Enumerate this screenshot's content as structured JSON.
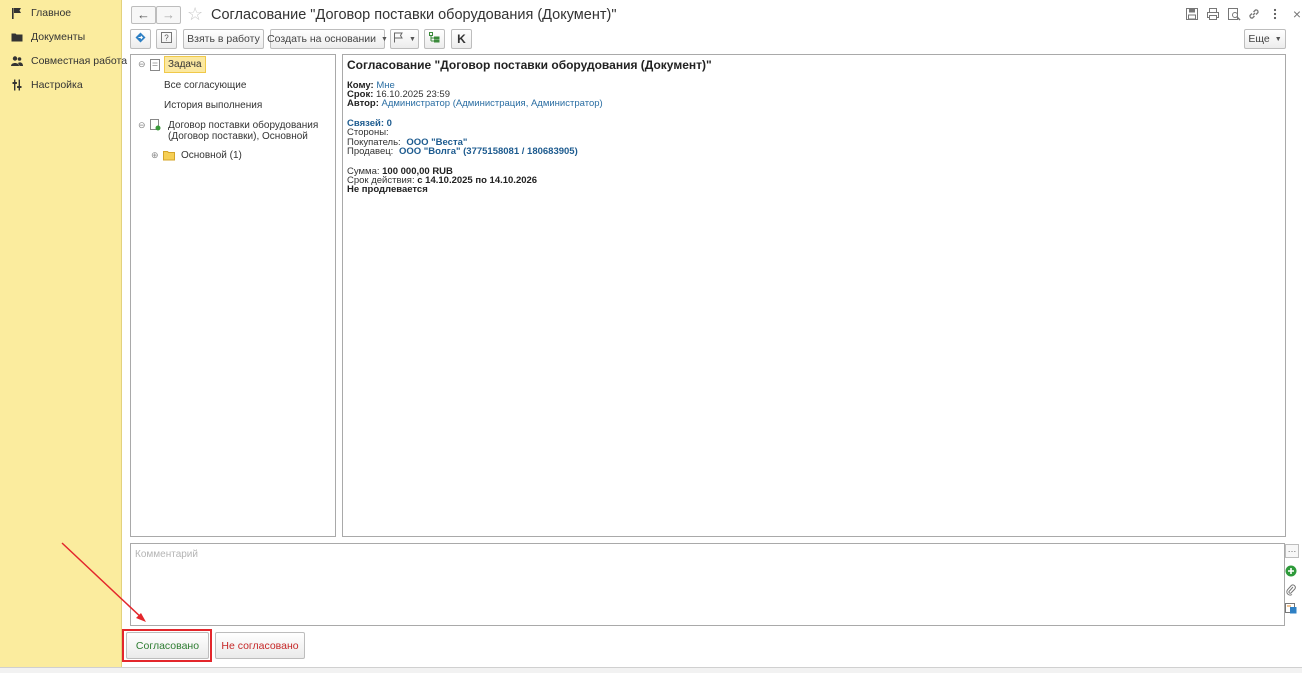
{
  "sidebar": {
    "items": [
      {
        "label": "Главное",
        "icon": "flag-icon"
      },
      {
        "label": "Документы",
        "icon": "folder-icon"
      },
      {
        "label": "Совместная работа",
        "icon": "users-icon"
      },
      {
        "label": "Настройка",
        "icon": "settings-icon"
      }
    ]
  },
  "header": {
    "title": "Согласование \"Договор поставки оборудования (Документ)\"",
    "back_icon": "←",
    "forward_icon": "→",
    "right_icons": [
      "save-icon",
      "print-icon",
      "preview-icon",
      "link-icon",
      "more-icon"
    ]
  },
  "toolbar": {
    "take_to_work": "Взять в работу",
    "create_based_on": "Создать на основании",
    "more": "Еще"
  },
  "tree": {
    "task": "Задача",
    "all_approvers": "Все согласующие",
    "history": "История выполнения",
    "contract_line1": "Договор поставки оборудования",
    "contract_line2": "(Договор поставки), Основной",
    "main_folder": "Основной (1)"
  },
  "content": {
    "title": "Согласование \"Договор поставки оборудования (Документ)\"",
    "to_label": "Кому:",
    "to_value": "Мне",
    "due_label": "Срок:",
    "due_value": "16.10.2025 23:59",
    "author_label": "Автор:",
    "author_value": "Администратор (Администрация, Администратор)",
    "links": "Связей: 0",
    "parties_label": "Стороны:",
    "buyer_label": "Покупатель:",
    "buyer_value": "ООО \"Веста\"",
    "seller_label": "Продавец:",
    "seller_value": "ООО \"Волга\" (3775158081 / 180683905)",
    "sum_label": "Сумма:",
    "sum_value": "100 000,00 RUB",
    "period_label": "Срок действия:",
    "period_value": "с 14.10.2025 по 14.10.2026",
    "renewal": "Не продлевается"
  },
  "comment": {
    "placeholder": "Комментарий",
    "value": ""
  },
  "actions": {
    "approve": "Согласовано",
    "reject": "Не согласовано"
  },
  "colors": {
    "sidebar_bg": "#fbec9e",
    "approve_text": "#2e7d32",
    "reject_text": "#c62828",
    "link": "#2b6ea3",
    "highlight": "#e3262b"
  }
}
